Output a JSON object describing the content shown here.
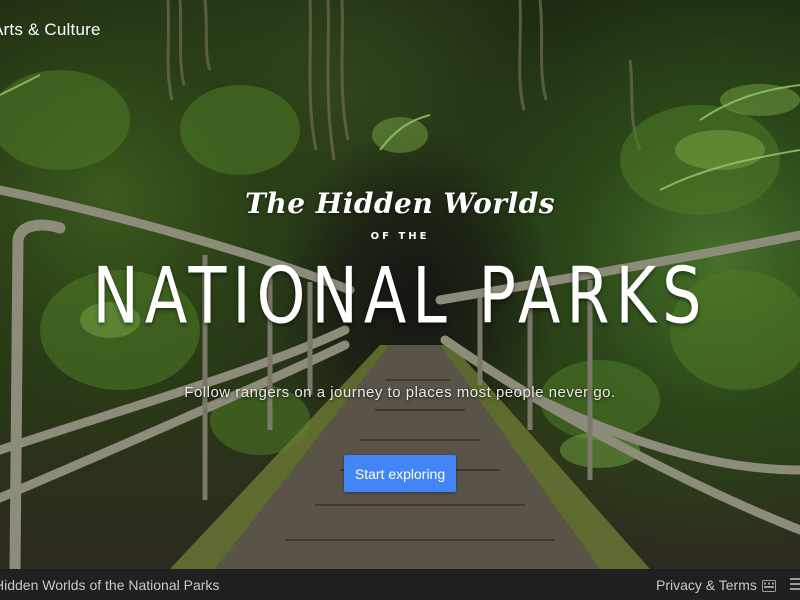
{
  "brand": {
    "name": "Arts & Culture"
  },
  "hero": {
    "script_title": "The Hidden Worlds",
    "small_title": "OF THE",
    "big_title": "NATIONAL PARKS",
    "subtitle": "Follow rangers on a journey to places most people never go.",
    "cta_label": "Start exploring"
  },
  "footer": {
    "title": "Hidden Worlds of the National Parks",
    "privacy_label": "Privacy & Terms",
    "icons": [
      "keyboard-icon",
      "menu-icon"
    ]
  },
  "colors": {
    "cta": "#4285f4",
    "footer_bg": "#202020",
    "footer_text": "#c8c8c8"
  }
}
